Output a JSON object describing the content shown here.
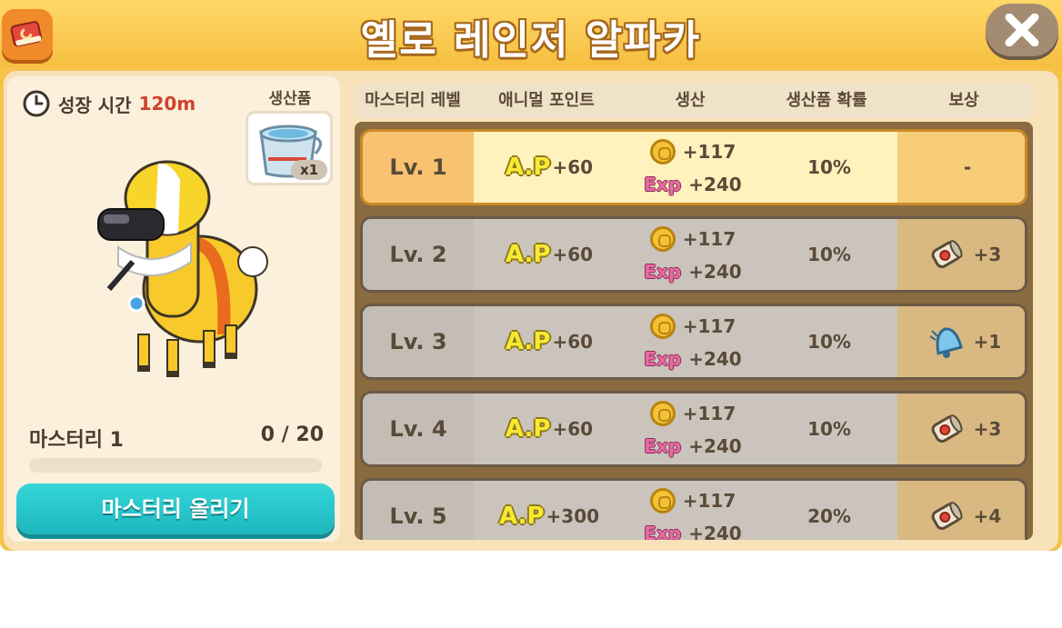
{
  "header": {
    "title": "옐로 레인저 알파카",
    "book_icon": "book-icon",
    "close_icon": "close-icon"
  },
  "left_panel": {
    "growth_label": "성장 시간",
    "growth_value": "120m",
    "product_label": "생산품",
    "product_icon": "milk-pail-icon",
    "product_qty": "x1",
    "animal_image": "yellow-ranger-alpaca",
    "mastery_label": "마스터리 1",
    "mastery_progress_text": "0 / 20",
    "mastery_progress_fraction": 0,
    "mastery_button": "마스터리 올리기"
  },
  "table": {
    "headers": [
      "마스터리 레벨",
      "애니멀 포인트",
      "생산",
      "생산품 확률",
      "보상"
    ],
    "ap_badge": "A.P",
    "exp_badge": "Exp",
    "rows": [
      {
        "level": "Lv. 1",
        "ap": "+60",
        "coin": "+117",
        "exp": "+240",
        "probability": "10%",
        "reward_icon": "",
        "reward": "-",
        "active": true
      },
      {
        "level": "Lv. 2",
        "ap": "+60",
        "coin": "+117",
        "exp": "+240",
        "probability": "10%",
        "reward_icon": "scroll-icon",
        "reward": "+3",
        "active": false
      },
      {
        "level": "Lv. 3",
        "ap": "+60",
        "coin": "+117",
        "exp": "+240",
        "probability": "10%",
        "reward_icon": "bell-icon",
        "reward": "+1",
        "active": false
      },
      {
        "level": "Lv. 4",
        "ap": "+60",
        "coin": "+117",
        "exp": "+240",
        "probability": "10%",
        "reward_icon": "scroll-icon",
        "reward": "+3",
        "active": false
      },
      {
        "level": "Lv. 5",
        "ap": "+300",
        "coin": "+117",
        "exp": "+240",
        "probability": "20%",
        "reward_icon": "scroll-icon",
        "reward": "+4",
        "active": false
      }
    ]
  },
  "colors": {
    "header": "#f5bf3f",
    "accent_teal": "#1db7bd",
    "growth_value": "#d2402a"
  }
}
